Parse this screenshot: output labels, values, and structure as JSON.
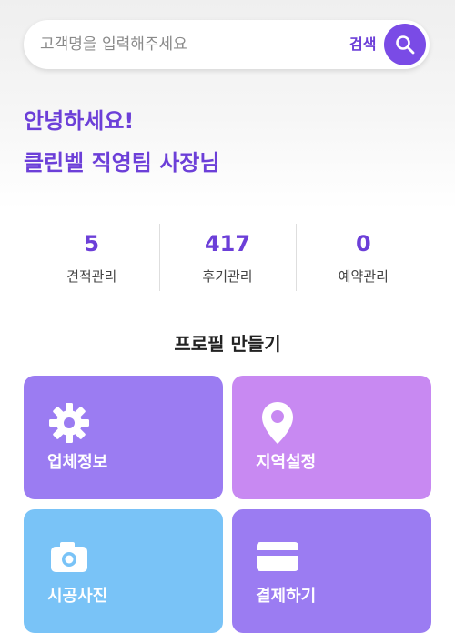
{
  "search": {
    "placeholder": "고객명을 입력해주세요",
    "value": "",
    "button_label": "검색",
    "icon": "search-icon"
  },
  "greeting": {
    "line1": "안녕하세요!",
    "line2": "클린벨 직영팀 사장님"
  },
  "stats": [
    {
      "value": "5",
      "label": "견적관리"
    },
    {
      "value": "417",
      "label": "후기관리"
    },
    {
      "value": "0",
      "label": "예약관리"
    }
  ],
  "profile": {
    "title": "프로필 만들기",
    "cards": [
      {
        "label": "업체정보",
        "icon": "gear-icon",
        "color": "#9b7cf2"
      },
      {
        "label": "지역설정",
        "icon": "map-pin-icon",
        "color": "#c889f2"
      },
      {
        "label": "시공사진",
        "icon": "camera-icon",
        "color": "#79c3f7"
      },
      {
        "label": "결제하기",
        "icon": "credit-card-icon",
        "color": "#9b7cf2"
      }
    ]
  },
  "colors": {
    "accent": "#6c3fd8",
    "search_button": "#7a4be6"
  }
}
